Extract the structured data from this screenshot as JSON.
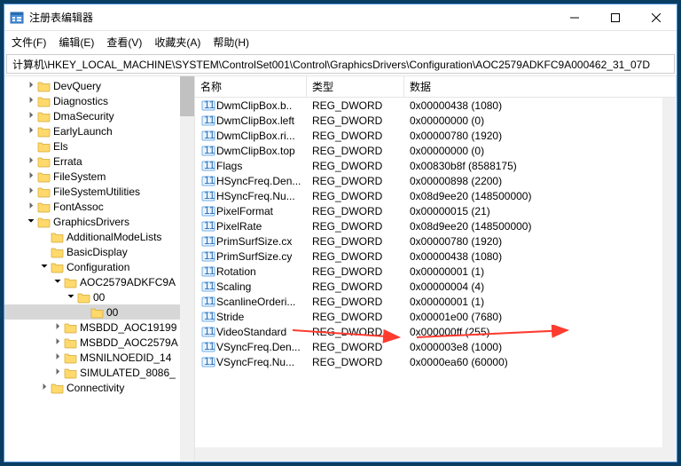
{
  "window": {
    "title": "注册表编辑器"
  },
  "menu": {
    "file": "文件(F)",
    "edit": "编辑(E)",
    "view": "查看(V)",
    "favorites": "收藏夹(A)",
    "help": "帮助(H)"
  },
  "address": "计算机\\HKEY_LOCAL_MACHINE\\SYSTEM\\ControlSet001\\Control\\GraphicsDrivers\\Configuration\\AOC2579ADKFC9A000462_31_07D",
  "columns": {
    "name": "名称",
    "type": "类型",
    "data": "数据"
  },
  "tree": [
    {
      "d": 1,
      "t": "DevQuery",
      "c": 1
    },
    {
      "d": 1,
      "t": "Diagnostics",
      "c": 1
    },
    {
      "d": 1,
      "t": "DmaSecurity",
      "c": 1
    },
    {
      "d": 1,
      "t": "EarlyLaunch",
      "c": 1
    },
    {
      "d": 1,
      "t": "Els",
      "c": 0
    },
    {
      "d": 1,
      "t": "Errata",
      "c": 1
    },
    {
      "d": 1,
      "t": "FileSystem",
      "c": 1
    },
    {
      "d": 1,
      "t": "FileSystemUtilities",
      "c": 1
    },
    {
      "d": 1,
      "t": "FontAssoc",
      "c": 1
    },
    {
      "d": 1,
      "t": "GraphicsDrivers",
      "c": 2
    },
    {
      "d": 2,
      "t": "AdditionalModeLists",
      "c": 0
    },
    {
      "d": 2,
      "t": "BasicDisplay",
      "c": 0
    },
    {
      "d": 2,
      "t": "Configuration",
      "c": 2
    },
    {
      "d": 3,
      "t": "AOC2579ADKFC9A",
      "c": 2
    },
    {
      "d": 4,
      "t": "00",
      "c": 2
    },
    {
      "d": 5,
      "t": "00",
      "c": 0,
      "sel": true
    },
    {
      "d": 3,
      "t": "MSBDD_AOC19199",
      "c": 1
    },
    {
      "d": 3,
      "t": "MSBDD_AOC2579A",
      "c": 1
    },
    {
      "d": 3,
      "t": "MSNILNOEDID_14",
      "c": 1
    },
    {
      "d": 3,
      "t": "SIMULATED_8086_",
      "c": 1
    },
    {
      "d": 2,
      "t": "Connectivity",
      "c": 1
    }
  ],
  "values": [
    {
      "n": "DwmClipBox.b..",
      "t": "REG_DWORD",
      "d": "0x00000438 (1080)"
    },
    {
      "n": "DwmClipBox.left",
      "t": "REG_DWORD",
      "d": "0x00000000 (0)"
    },
    {
      "n": "DwmClipBox.ri...",
      "t": "REG_DWORD",
      "d": "0x00000780 (1920)"
    },
    {
      "n": "DwmClipBox.top",
      "t": "REG_DWORD",
      "d": "0x00000000 (0)"
    },
    {
      "n": "Flags",
      "t": "REG_DWORD",
      "d": "0x00830b8f (8588175)"
    },
    {
      "n": "HSyncFreq.Den...",
      "t": "REG_DWORD",
      "d": "0x00000898 (2200)"
    },
    {
      "n": "HSyncFreq.Nu...",
      "t": "REG_DWORD",
      "d": "0x08d9ee20 (148500000)"
    },
    {
      "n": "PixelFormat",
      "t": "REG_DWORD",
      "d": "0x00000015 (21)"
    },
    {
      "n": "PixelRate",
      "t": "REG_DWORD",
      "d": "0x08d9ee20 (148500000)"
    },
    {
      "n": "PrimSurfSize.cx",
      "t": "REG_DWORD",
      "d": "0x00000780 (1920)"
    },
    {
      "n": "PrimSurfSize.cy",
      "t": "REG_DWORD",
      "d": "0x00000438 (1080)"
    },
    {
      "n": "Rotation",
      "t": "REG_DWORD",
      "d": "0x00000001 (1)"
    },
    {
      "n": "Scaling",
      "t": "REG_DWORD",
      "d": "0x00000004 (4)",
      "hl": true
    },
    {
      "n": "ScanlineOrderi...",
      "t": "REG_DWORD",
      "d": "0x00000001 (1)"
    },
    {
      "n": "Stride",
      "t": "REG_DWORD",
      "d": "0x00001e00 (7680)"
    },
    {
      "n": "VideoStandard",
      "t": "REG_DWORD",
      "d": "0x000000ff (255)"
    },
    {
      "n": "VSyncFreq.Den...",
      "t": "REG_DWORD",
      "d": "0x000003e8 (1000)"
    },
    {
      "n": "VSyncFreq.Nu...",
      "t": "REG_DWORD",
      "d": "0x0000ea60 (60000)"
    }
  ],
  "annotations": {
    "highlight_value": "Scaling"
  }
}
